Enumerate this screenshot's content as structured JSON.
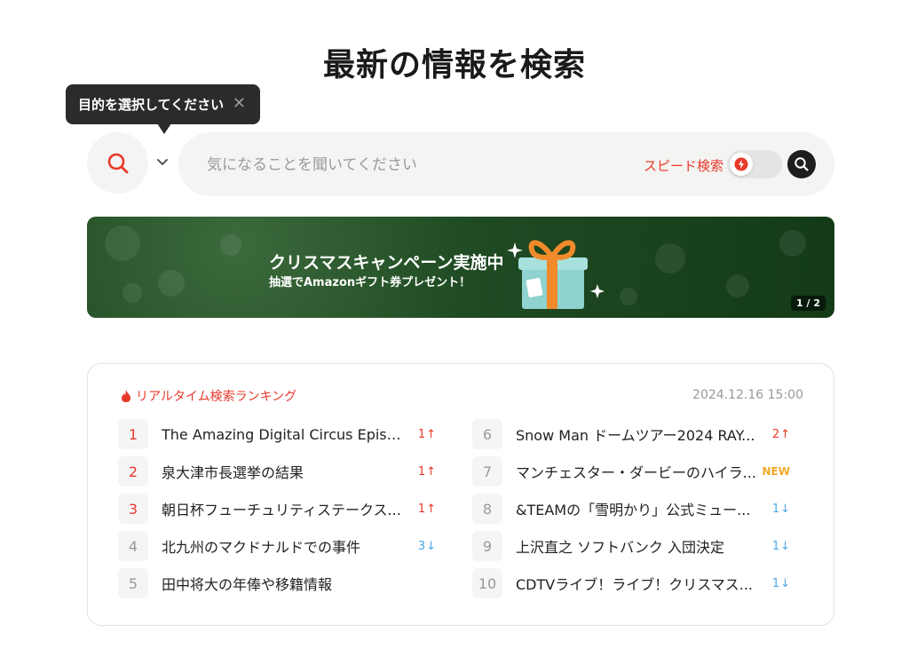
{
  "page": {
    "title": "最新の情報を検索"
  },
  "tooltip": {
    "text": "目的を選択してください",
    "close": "✕"
  },
  "search": {
    "placeholder": "気になることを聞いてください",
    "speed_label": "スピード検索",
    "speed_enabled": false
  },
  "banner": {
    "title": "クリスマスキャンペーン実施中",
    "subtitle": "抽選でAmazonギフト券プレゼント！",
    "pager": "1 / 2"
  },
  "ranking": {
    "title": "リアルタイム検索ランキング",
    "timestamp": "2024.12.16 15:00",
    "left": [
      {
        "rank": "1",
        "text": "The Amazing Digital Circus Episo...",
        "change": "1",
        "dir": "up"
      },
      {
        "rank": "2",
        "text": "泉大津市長選挙の結果",
        "change": "1",
        "dir": "up"
      },
      {
        "rank": "3",
        "text": "朝日杯フューチュリティステークス...",
        "change": "1",
        "dir": "up"
      },
      {
        "rank": "4",
        "text": "北九州のマクドナルドでの事件",
        "change": "3",
        "dir": "down"
      },
      {
        "rank": "5",
        "text": "田中将大の年俸や移籍情報",
        "change": "",
        "dir": "none"
      }
    ],
    "right": [
      {
        "rank": "6",
        "text": "Snow Man ドームツアー2024 RAY...",
        "change": "2",
        "dir": "up"
      },
      {
        "rank": "7",
        "text": "マンチェスター・ダービーのハイラ...",
        "change": "NEW",
        "dir": "new"
      },
      {
        "rank": "8",
        "text": "&TEAMの「雪明かり」公式ミュー...",
        "change": "1",
        "dir": "down"
      },
      {
        "rank": "9",
        "text": "上沢直之 ソフトバンク 入団決定",
        "change": "1",
        "dir": "down"
      },
      {
        "rank": "10",
        "text": "CDTVライブ！ライブ！クリスマス...",
        "change": "1",
        "dir": "down"
      }
    ]
  },
  "colors": {
    "accent": "#e8382a",
    "down": "#4aa8e8",
    "new": "#f0a826",
    "banner_bg": "#1f4a22"
  }
}
